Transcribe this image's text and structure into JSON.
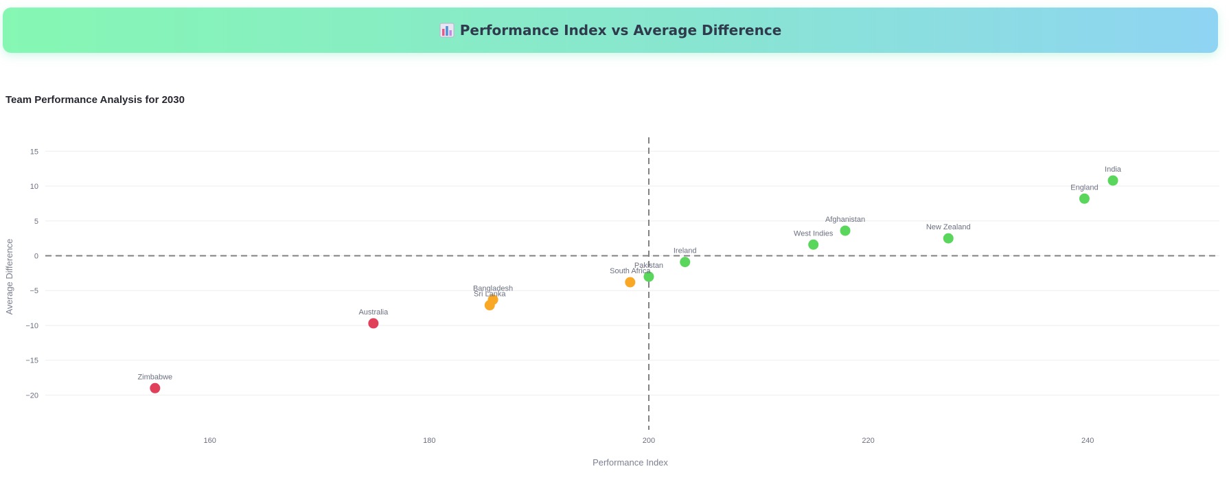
{
  "header": {
    "icon": "bar-chart-icon",
    "title": "Performance Index vs Average Difference"
  },
  "subtitle": "Team Performance Analysis for 2030",
  "colors": {
    "good": "#5ad65c",
    "mid": "#f9a825",
    "bad": "#e0405a",
    "grid": "#eeeeee",
    "refline": "#808080"
  },
  "chart_data": {
    "type": "scatter",
    "xlabel": "Performance Index",
    "ylabel": "Average Difference",
    "xlim": [
      145,
      252
    ],
    "ylim": [
      -24,
      17
    ],
    "xticks": [
      160,
      180,
      200,
      220,
      240
    ],
    "yticks": [
      15,
      10,
      5,
      0,
      -5,
      -10,
      -15,
      -20
    ],
    "reference_lines": {
      "x": 200,
      "y": 0
    },
    "grid": true,
    "points": [
      {
        "team": "India",
        "x": 242.3,
        "y": 10.8,
        "group": "good"
      },
      {
        "team": "England",
        "x": 239.7,
        "y": 8.2,
        "group": "good"
      },
      {
        "team": "Afghanistan",
        "x": 217.9,
        "y": 3.6,
        "group": "good"
      },
      {
        "team": "New Zealand",
        "x": 227.3,
        "y": 2.5,
        "group": "good"
      },
      {
        "team": "West Indies",
        "x": 215.0,
        "y": 1.6,
        "group": "good"
      },
      {
        "team": "Ireland",
        "x": 203.3,
        "y": -0.9,
        "group": "good"
      },
      {
        "team": "Pakistan",
        "x": 200.0,
        "y": -3.0,
        "group": "good"
      },
      {
        "team": "South Africa",
        "x": 198.3,
        "y": -3.8,
        "group": "mid"
      },
      {
        "team": "Bangladesh",
        "x": 185.8,
        "y": -6.3,
        "group": "mid"
      },
      {
        "team": "Sri Lanka",
        "x": 185.5,
        "y": -7.1,
        "group": "mid"
      },
      {
        "team": "Australia",
        "x": 174.9,
        "y": -9.7,
        "group": "bad"
      },
      {
        "team": "Zimbabwe",
        "x": 155.0,
        "y": -19.0,
        "group": "bad"
      }
    ]
  }
}
